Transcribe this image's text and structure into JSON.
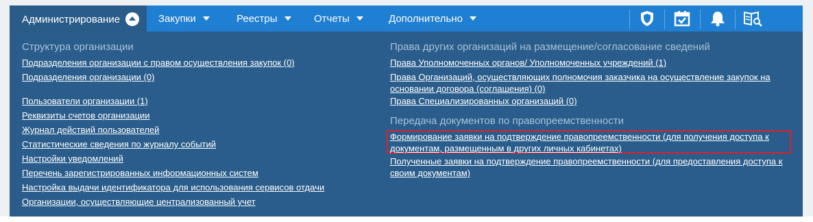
{
  "nav": {
    "items": [
      {
        "label": "Администрирование"
      },
      {
        "label": "Закупки"
      },
      {
        "label": "Реестры"
      },
      {
        "label": "Отчеты"
      },
      {
        "label": "Дополнительно"
      }
    ],
    "icons": [
      "shield-icon",
      "calendar-check-icon",
      "bell-icon",
      "book-search-icon"
    ]
  },
  "left_column": {
    "heading": "Структура организации",
    "links": [
      "Подразделения организации с правом осуществления закупок (0)",
      "Подразделения организации (0)",
      "Пользователи организации (1)",
      "Реквизиты счетов организации",
      "Журнал действий пользователей",
      "Статистические сведения по журналу событий",
      "Настройки уведомлений",
      "Перечень зарегистрированных информационных систем",
      "Настройка выдачи идентификатора для использования сервисов отдачи",
      "Организации, осуществляющие централизованный учет"
    ]
  },
  "right_column": {
    "section1_heading": "Права других организаций на размещение/согласование сведений",
    "section1_links": [
      "Права Уполномоченных органов/ Уполномоченных учреждений (1)",
      "Права Организаций, осуществляющих полномочия заказчика на осуществление закупок на основании договора (соглашения) (0)",
      "Права Специализированных организаций (0)"
    ],
    "section2_heading": "Передача документов по правопреемственности",
    "section2_links": [
      "Формирование заявки на подтверждение правопреемственности (для получения доступа к документам, размещенным в других личных кабинетах)",
      "Полученные заявки на подтверждение правопреемственности (для предоставления доступа к своим документам)"
    ]
  },
  "colors": {
    "menubar": "#1f7fd3",
    "panel": "#2a5d8b",
    "heading": "#a8c2da",
    "highlight": "#e0202a"
  }
}
